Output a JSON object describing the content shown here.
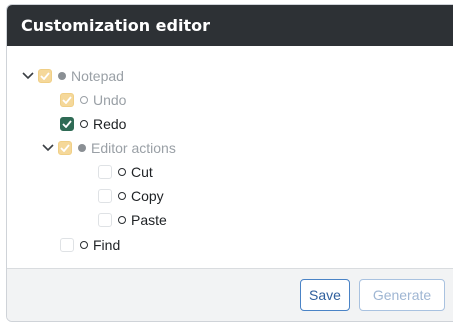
{
  "dialog": {
    "title": "Customization editor"
  },
  "tree": {
    "items": [
      {
        "label": "Notepad",
        "checkbox": "disabled-checked",
        "bullet": "filled",
        "expanded": true
      },
      {
        "label": "Undo",
        "checkbox": "disabled-checked",
        "bullet": "hollow"
      },
      {
        "label": "Redo",
        "checkbox": "checked",
        "bullet": "hollow"
      },
      {
        "label": "Editor actions",
        "checkbox": "disabled-checked",
        "bullet": "filled",
        "expanded": true
      },
      {
        "label": "Cut",
        "checkbox": "unchecked",
        "bullet": "hollow"
      },
      {
        "label": "Copy",
        "checkbox": "unchecked",
        "bullet": "hollow"
      },
      {
        "label": "Paste",
        "checkbox": "unchecked",
        "bullet": "hollow"
      },
      {
        "label": "Find",
        "checkbox": "unchecked",
        "bullet": "hollow"
      }
    ]
  },
  "footer": {
    "save_label": "Save",
    "generate_label": "Generate"
  },
  "colors": {
    "header_bg": "#2d3135",
    "checked": "#2f6b55",
    "disabled_checked": "#f5d89a",
    "primary_border": "#4a83c6"
  },
  "icons": {
    "expand": "chevron-down-icon",
    "check": "checkmark-icon"
  }
}
